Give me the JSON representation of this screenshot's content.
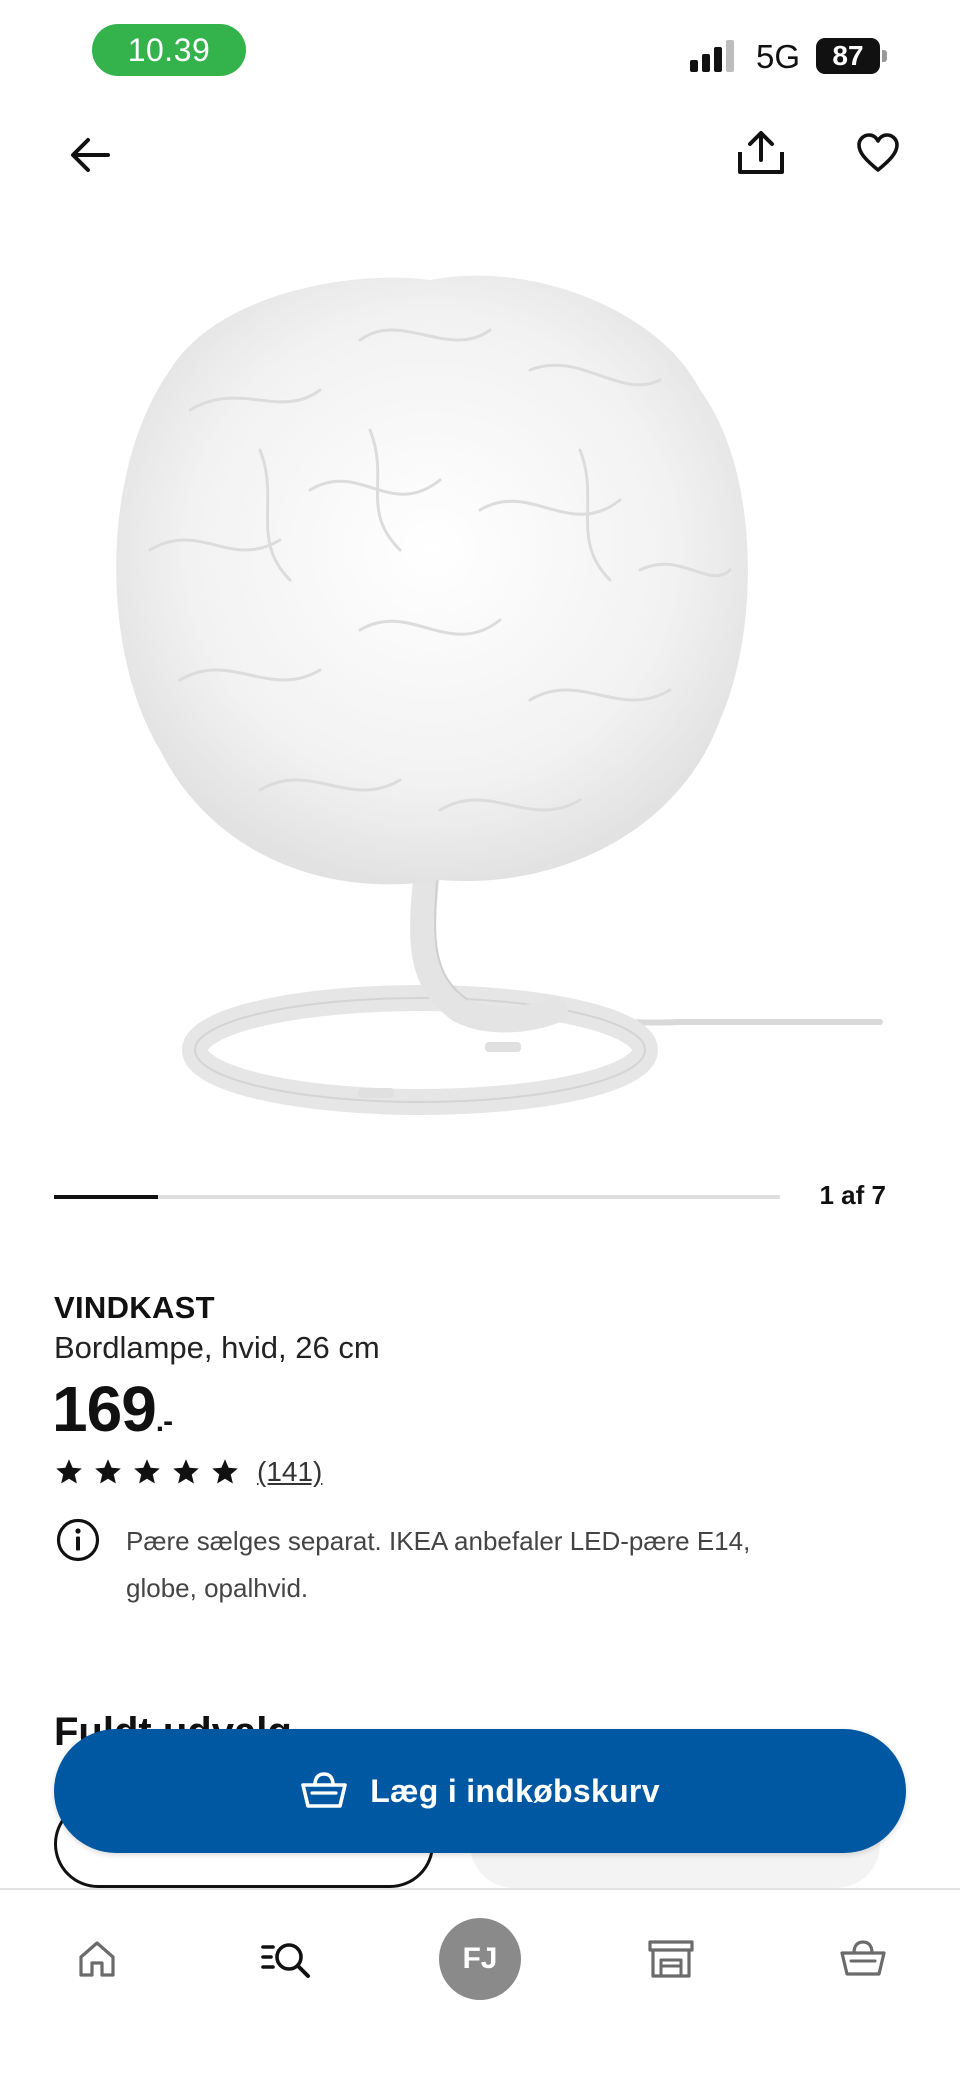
{
  "status_bar": {
    "time": "10.39",
    "network": "5G",
    "battery": "87"
  },
  "colors": {
    "accent_blue": "#0058a3",
    "status_green": "#34b24c",
    "avatar_grey": "#8a8a8a"
  },
  "icons": {
    "back": "arrow-left-icon",
    "share": "share-icon",
    "favorite": "heart-icon",
    "info": "info-icon",
    "cart": "basket-icon",
    "nav_home": "home-icon",
    "nav_search": "search-list-icon",
    "nav_store": "store-icon",
    "nav_cart": "basket-icon"
  },
  "carousel": {
    "counter": "1 af 7",
    "current": 1,
    "total": 7
  },
  "product": {
    "name": "VINDKAST",
    "description": "Bordlampe, hvid, 26 cm",
    "price": "169",
    "price_suffix": ".-",
    "rating": 5,
    "review_count": "(141)",
    "info_text": "Pære sælges separat. IKEA anbefaler LED-pære E14, globe, opalhvid."
  },
  "section": {
    "heading": "Fuldt udvalg"
  },
  "cart_button": {
    "label": "Læg i indkøbskurv"
  },
  "bottom_nav": {
    "profile_initials": "FJ"
  }
}
